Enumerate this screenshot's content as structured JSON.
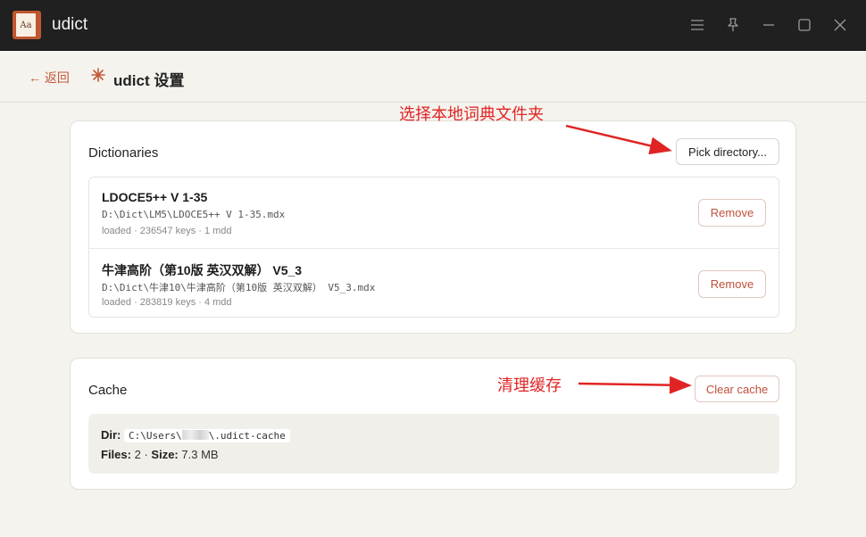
{
  "app": {
    "title": "udict",
    "icon_text": "Aa"
  },
  "window_controls": [
    "menu-icon",
    "pin-icon",
    "minimize-icon",
    "maximize-icon",
    "close-icon"
  ],
  "topbar": {
    "back_label": "← 返回",
    "title": "udict 设置"
  },
  "dictionaries": {
    "title": "Dictionaries",
    "pick_label": "Pick directory...",
    "items": [
      {
        "name": "LDOCE5++ V 1-35",
        "path": "D:\\Dict\\LM5\\LDOCE5++ V 1-35.mdx",
        "meta": "loaded · 236547 keys · 1 mdd",
        "remove_label": "Remove"
      },
      {
        "name": "牛津高阶（第10版 英汉双解） V5_3",
        "path": "D:\\Dict\\牛津10\\牛津高阶（第10版 英汉双解） V5_3.mdx",
        "meta": "loaded · 283819 keys · 4 mdd",
        "remove_label": "Remove"
      }
    ]
  },
  "cache": {
    "title": "Cache",
    "clear_label": "Clear cache",
    "dir_label": "Dir:",
    "dir_prefix": "C:\\Users\\",
    "dir_suffix": "\\.udict-cache",
    "files_label": "Files:",
    "files_value": "2",
    "size_label": "Size:",
    "size_value": "7.3 MB"
  },
  "annotations": {
    "pick_note": "选择本地词典文件夹",
    "cache_note": "清理缓存"
  },
  "colors": {
    "accent": "#c2593a",
    "annotation": "#e02424",
    "titlebar": "#202020"
  }
}
